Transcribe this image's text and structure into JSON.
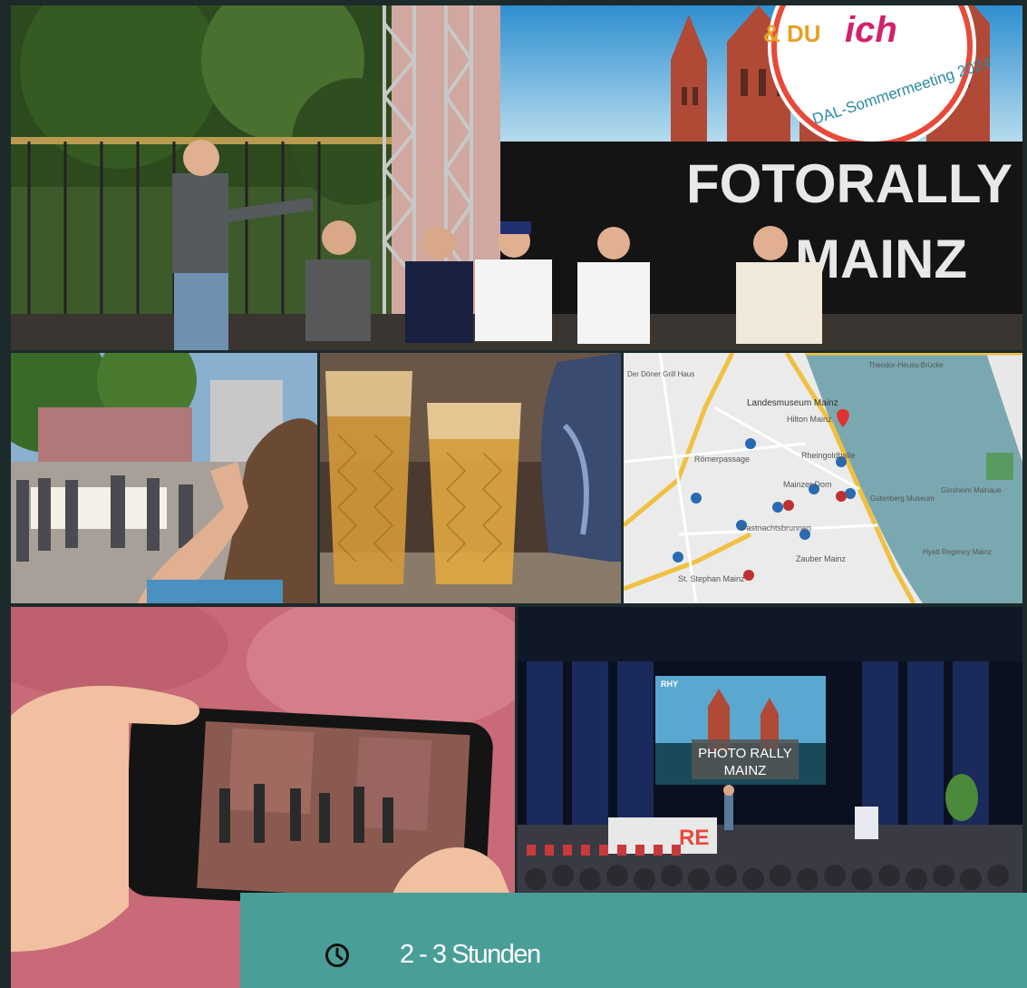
{
  "photos": {
    "stage": {
      "banner_line1": "FOTORALLY",
      "banner_line2": "MAINZ",
      "logo_text": "DAL-Sommermeeting 2024",
      "logo_amp": "& DU",
      "logo_ich": "ich"
    },
    "map": {
      "labels": [
        "Landesmuseum Mainz",
        "Hilton Mainz",
        "Rheingoldhalle",
        "Römerpassage",
        "Fastnachtsbrunnen",
        "Mainzer Dom",
        "St. Stephan Mainz",
        "Hyatt Regency Mainz",
        "Zauber Mainz",
        "Theodor-Heuss-Brücke",
        "Gutenberg Museum",
        "Ginsheim Mainaue",
        "Der Döner Grill Haus"
      ]
    },
    "presentation": {
      "screen_line1": "PHOTO RALLY",
      "screen_line2": "MAINZ",
      "screen_brand": "RHY",
      "podium_text": "RE"
    }
  },
  "info": {
    "duration": "2 - 3 Stunden",
    "icon": "clock-icon"
  },
  "colors": {
    "banner": "#4a9e98",
    "background": "#1c2a2c"
  }
}
